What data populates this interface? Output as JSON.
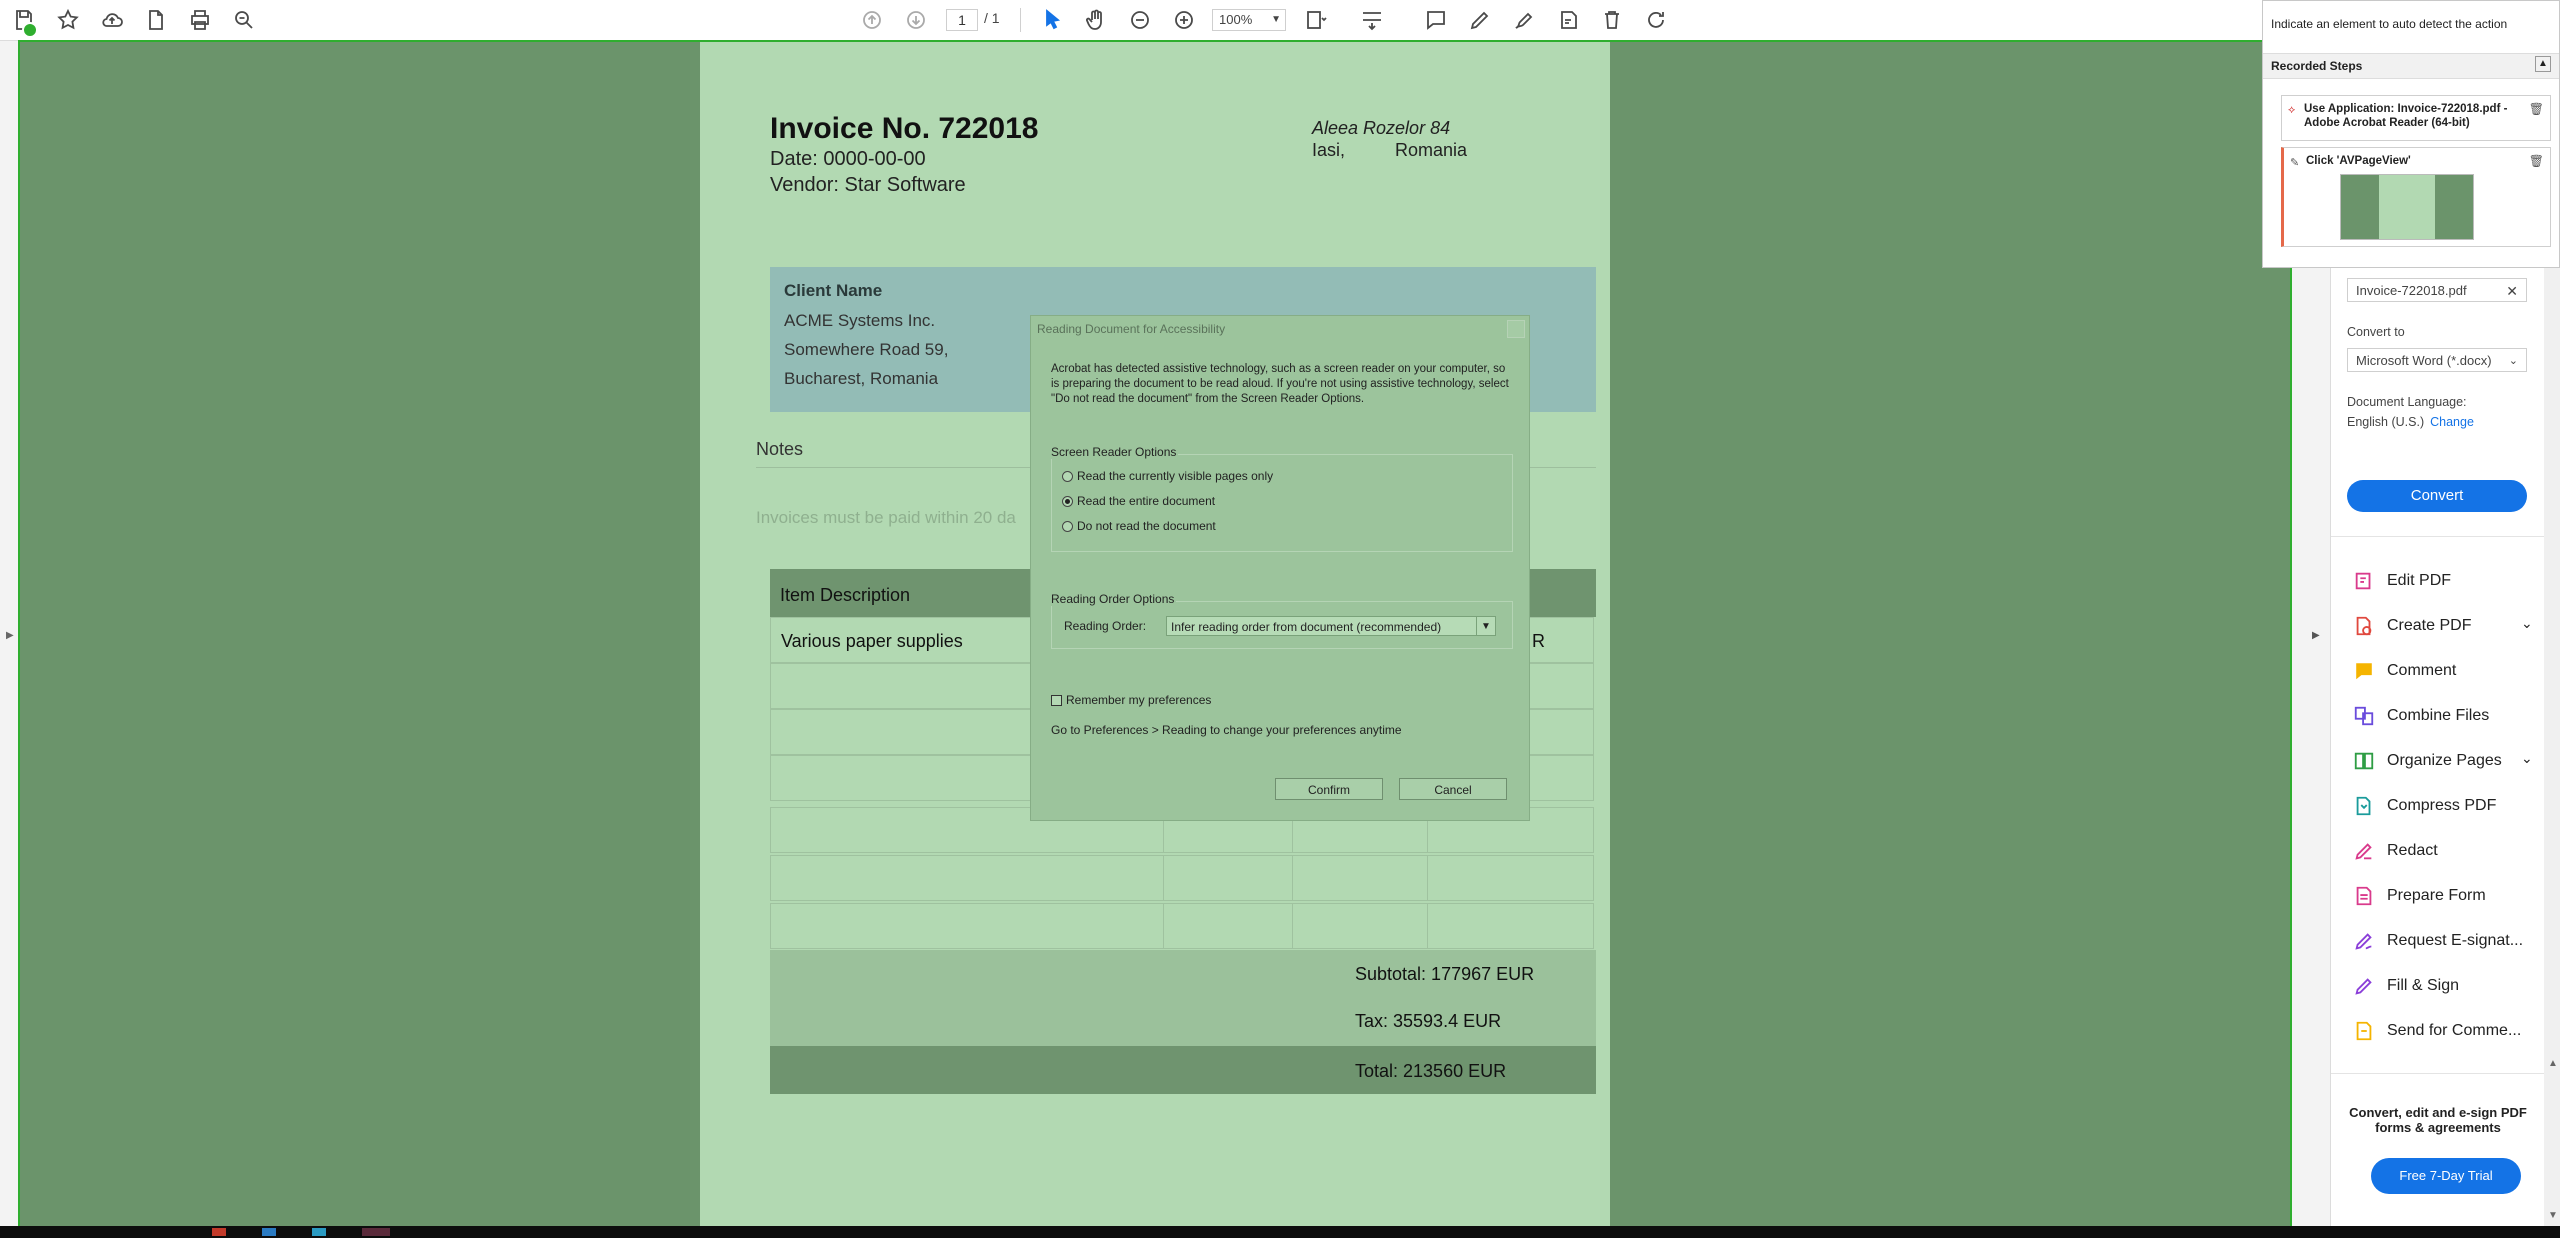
{
  "toolbar": {
    "page_current": "1",
    "page_total": "/ 1",
    "zoom": "100%"
  },
  "invoice": {
    "title": "Invoice No. 722018",
    "date": "Date: 0000-00-00",
    "vendor": "Vendor: Star Software",
    "address_line1": "Aleea Rozelor 84",
    "address_city": "Iasi,",
    "address_country": "Romania",
    "client_label": "Client Name",
    "client_lines": [
      "ACME Systems Inc.",
      "Somewhere Road 59,",
      "Bucharest, Romania"
    ],
    "notes_heading": "Notes",
    "notes_text": "Invoices must be paid within 20 da",
    "table_header": "Item Description",
    "item_1": "Various paper supplies",
    "item_1_tail": "R",
    "subtotal": "Subtotal: 177967 EUR",
    "tax": "Tax: 35593.4 EUR",
    "total": "Total: 213560 EUR"
  },
  "dialog": {
    "title": "Reading Document for Accessibility",
    "message": "Acrobat has detected assistive technology, such as a screen reader on your computer, so is preparing the document to be read aloud. If you're not using assistive technology, select \"Do not read the document\" from the Screen Reader Options.",
    "screen_reader_group": "Screen Reader Options",
    "opt_visible": "Read the currently visible pages only",
    "opt_entire": "Read the entire document",
    "opt_none": "Do not read the document",
    "reading_order_group": "Reading Order Options",
    "reading_order_label": "Reading Order:",
    "reading_order_value": "Infer reading order from document (recommended)",
    "remember": "Remember my preferences",
    "hint": "Go to Preferences > Reading to change your preferences anytime",
    "confirm": "Confirm",
    "cancel": "Cancel"
  },
  "right_panel": {
    "file_name": "Invoice-722018.pdf",
    "convert_to_label": "Convert to",
    "convert_to_value": "Microsoft Word (*.docx)",
    "doc_lang_label": "Document Language:",
    "doc_lang_value": "English (U.S.)",
    "change_link": "Change",
    "convert_button": "Convert",
    "tools": [
      {
        "label": "Edit PDF"
      },
      {
        "label": "Create PDF"
      },
      {
        "label": "Comment"
      },
      {
        "label": "Combine Files"
      },
      {
        "label": "Organize Pages"
      },
      {
        "label": "Compress PDF"
      },
      {
        "label": "Redact"
      },
      {
        "label": "Prepare Form"
      },
      {
        "label": "Request E-signat..."
      },
      {
        "label": "Fill & Sign"
      },
      {
        "label": "Send for Comme..."
      }
    ],
    "promo": "Convert, edit and e-sign PDF forms & agreements",
    "trial_button": "Free 7-Day Trial"
  },
  "recorder": {
    "hint": "Indicate an element to auto detect the action",
    "heading": "Recorded Steps",
    "step_1": "Use Application: Invoice-722018.pdf - Adobe Acrobat Reader (64-bit)",
    "step_2": "Click 'AVPageView'"
  },
  "colors": {
    "accent": "#1473e6",
    "overlay_green": "#2fae2f",
    "page_green": "#b2d9b2",
    "doc_bg_green": "#6b946b"
  }
}
